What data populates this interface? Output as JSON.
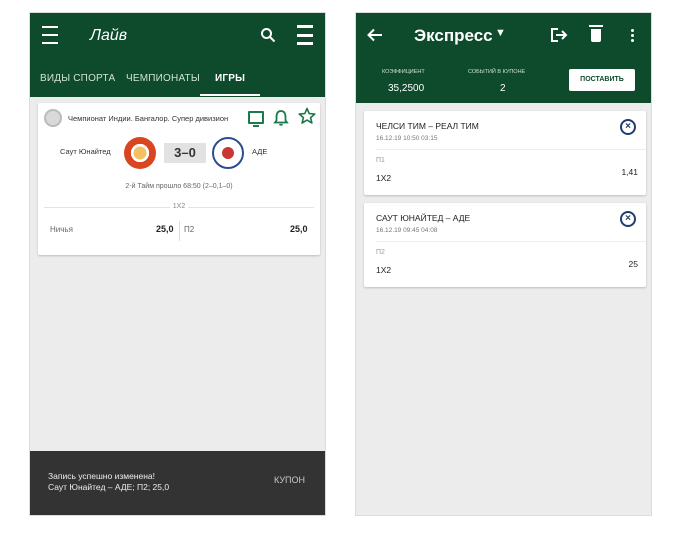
{
  "top_fragment": "",
  "live": {
    "title": "Лайв",
    "tabs": [
      "ВИДЫ СПОРТА",
      "ЧЕМПИОНАТЫ",
      "ИГРЫ"
    ],
    "match": {
      "league": "Чемпионат Индии. Бангалор. Супер дивизион",
      "team1": "Саут Юнайтед",
      "team2": "АДЕ",
      "score": "3–0",
      "status": "2-й Тайм прошло 68:50 (2–0,1–0)",
      "market": "1X2",
      "odds": [
        {
          "name": "Ничья",
          "value": "25,0"
        },
        {
          "name": "П2",
          "value": "25,0"
        }
      ]
    },
    "snackbar": {
      "line1": "Запись успешно изменена!",
      "line2": "Саут Юнайтед – АДЕ; П2; 25,0",
      "action": "КУПОН"
    }
  },
  "express": {
    "title": "Экспресс",
    "coef_label": "КОЭФФИЦИЕНТ",
    "coef_value": "35,2500",
    "events_label": "СОБЫТИЙ В КУПОНЕ",
    "events_value": "2",
    "place_bet": "ПОСТАВИТЬ",
    "bets": [
      {
        "teams": "ЧЕЛСИ ТИМ – РЕАЛ ТИМ",
        "date": "16.12.19 10:50 03:15",
        "outcome": "П1",
        "type": "1X2",
        "odd": "1,41"
      },
      {
        "teams": "САУТ ЮНАЙТЕД – АДЕ",
        "date": "16.12.19 09:45 04:08",
        "outcome": "П2",
        "type": "1X2",
        "odd": "25"
      }
    ]
  }
}
